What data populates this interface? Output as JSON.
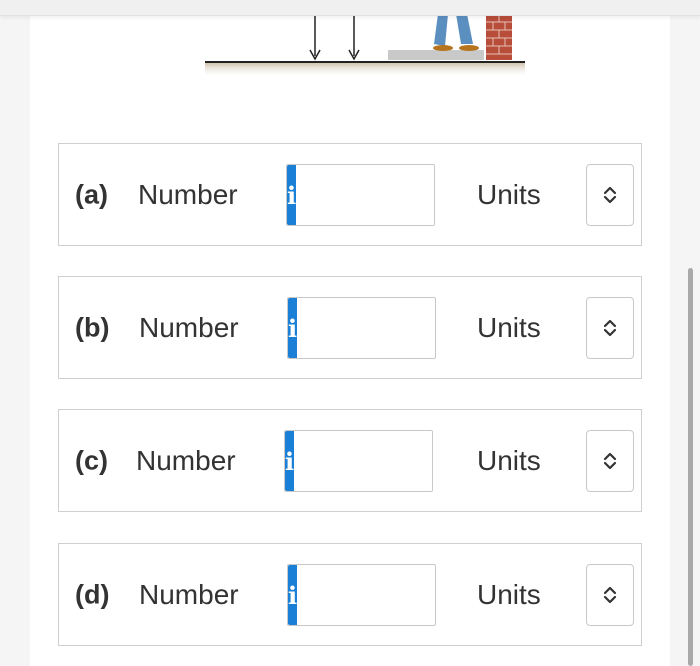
{
  "questions": [
    {
      "part": "(a)",
      "number_label": "Number",
      "info_icon": "i",
      "value": "",
      "units_label": "Units",
      "units_value": ""
    },
    {
      "part": "(b)",
      "number_label": "Number",
      "info_icon": "i",
      "value": "",
      "units_label": "Units",
      "units_value": ""
    },
    {
      "part": "(c)",
      "number_label": "Number",
      "info_icon": "i",
      "value": "",
      "units_label": "Units",
      "units_value": ""
    },
    {
      "part": "(d)",
      "number_label": "Number",
      "info_icon": "i",
      "value": "",
      "units_label": "Units",
      "units_value": ""
    }
  ],
  "icons": {
    "info": "info-icon",
    "units_toggle": "chevron-up-down-icon"
  },
  "colors": {
    "info_button": "#1a7fd6",
    "row_border": "#cfcfcf",
    "text": "#333333"
  }
}
